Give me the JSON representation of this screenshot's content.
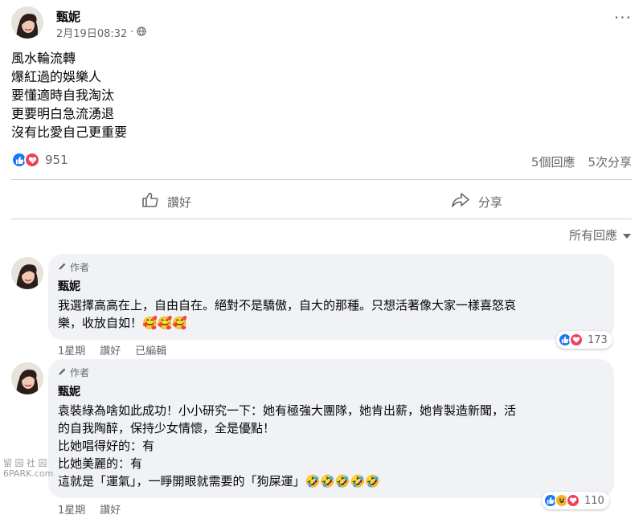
{
  "post": {
    "author": "甄妮",
    "timestamp": "2月19日08:32",
    "audience_icon": "globe-icon",
    "more_icon": "more-options-icon",
    "more_label": "···",
    "lines": [
      "風水輪流轉",
      "爆紅過的娛樂人",
      "要懂適時自我淘汰",
      "更要明白急流湧退",
      "沒有比愛自己更重要"
    ]
  },
  "stats": {
    "reaction_count": "951",
    "comments": "5個回應",
    "shares": "5次分享"
  },
  "actions": {
    "like": "讚好",
    "share": "分享"
  },
  "sort": {
    "label": "所有回應",
    "icon": "caret-down-icon"
  },
  "comments": [
    {
      "author_tag": "作者",
      "name": "甄妮",
      "lines": [
        "我選擇高高在上，自由自在。絕對不是驕傲，自大的那種。只想活著像大家一樣喜怒哀",
        "樂，收放自如！🥰🥰🥰"
      ],
      "actions": [
        "1星期",
        "讚好",
        "已編輯"
      ],
      "reaction_count": "173"
    },
    {
      "author_tag": "作者",
      "name": "甄妮",
      "lines": [
        "袁裝綠為啥如此成功！小小研究一下：她有極強大團隊，她肯出薪，她肯製造新聞，活",
        "的自我陶醉，保持少女情懷，全是優點！",
        "比她唱得好的：有",
        "比她美麗的：有",
        "這就是「運氣」，一睜開眼就需要的「狗屎運」🤣🤣🤣🤣🤣"
      ],
      "actions": [
        "1星期",
        "讚好"
      ],
      "reaction_count": "110"
    }
  ],
  "watermark": {
    "line1": "留 园 社 园",
    "line2": "6PARK.com"
  },
  "colors": {
    "like": "#1877f2",
    "love": "#f33e58",
    "haha": "#f7b125",
    "secondary_text": "#65676b",
    "bubble": "#f0f2f5"
  }
}
